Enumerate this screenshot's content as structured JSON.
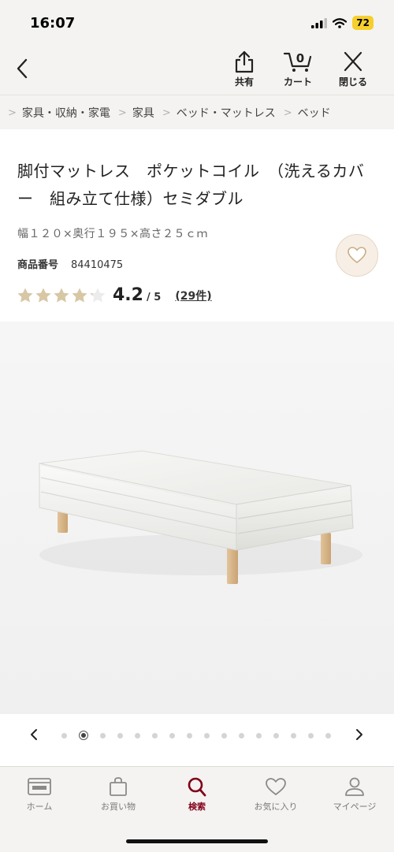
{
  "status": {
    "time": "16:07",
    "battery": "72"
  },
  "nav": {
    "share_label": "共有",
    "cart_label": "カート",
    "cart_count": "0",
    "close_label": "閉じる"
  },
  "breadcrumb": [
    "家具・収納・家電",
    "家具",
    "ベッド・マットレス",
    "ベッド"
  ],
  "product": {
    "title": "脚付マットレス　ポケットコイル　（洗えるカバー　組み立て仕様）セミダブル",
    "size": "幅１２０×奥行１９５×高さ２５ｃｍ",
    "number_label": "商品番号",
    "number": "84410475",
    "rating": "4.2",
    "rating_max": "/ 5",
    "rating_count": "(29件)",
    "rating_value": 4.2
  },
  "carousel": {
    "total": 16,
    "active_index": 1
  },
  "tabs": [
    {
      "label": "ホーム",
      "icon": "home-icon"
    },
    {
      "label": "お買い物",
      "icon": "shopping-bag-icon"
    },
    {
      "label": "検索",
      "icon": "search-icon"
    },
    {
      "label": "お気に入り",
      "icon": "heart-icon"
    },
    {
      "label": "マイページ",
      "icon": "person-icon"
    }
  ],
  "colors": {
    "accent": "#7f0019",
    "star": "#d8c7a5",
    "favorite_bg": "#f7efe5",
    "chrome_bg": "#f4f3f1"
  }
}
